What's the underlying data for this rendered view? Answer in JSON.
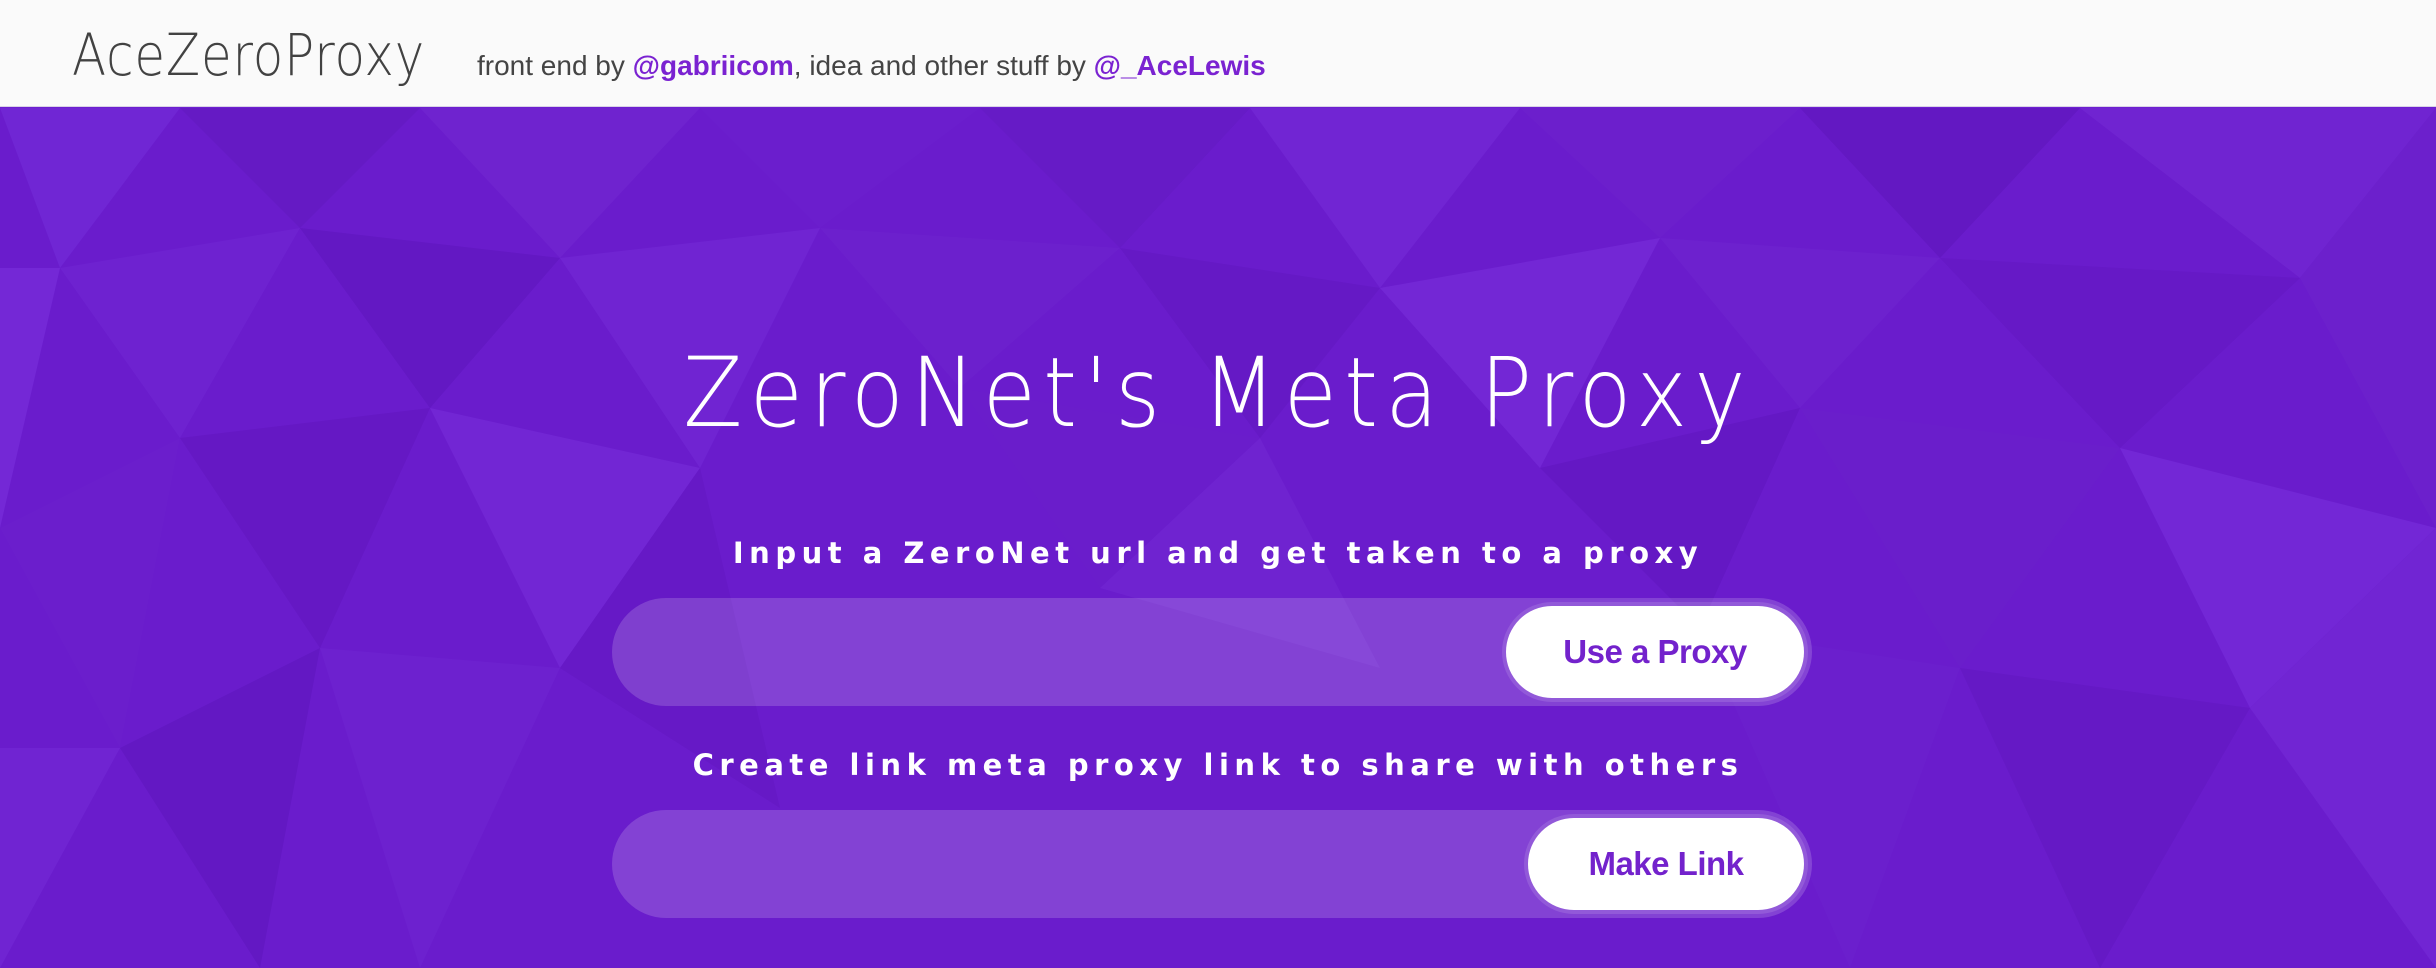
{
  "header": {
    "logo": "AceZeroProxy",
    "credits_prefix": "front end by ",
    "credits_author1": "@gabriicom",
    "credits_middle": ", idea and other stuff by ",
    "credits_author2": "@_AceLewis"
  },
  "hero": {
    "title": "ZeroNet's Meta Proxy",
    "proxy_section": {
      "label": "Input a ZeroNet url and get taken to a proxy",
      "input_value": "",
      "button_label": "Use a Proxy"
    },
    "link_section": {
      "label": "Create link meta proxy link to share with others",
      "input_value": "",
      "button_label": "Make Link"
    }
  },
  "colors": {
    "brand_purple": "#6c1fd0",
    "link_purple": "#7a22d1",
    "header_bg": "#fafafa",
    "header_text": "#424242"
  }
}
